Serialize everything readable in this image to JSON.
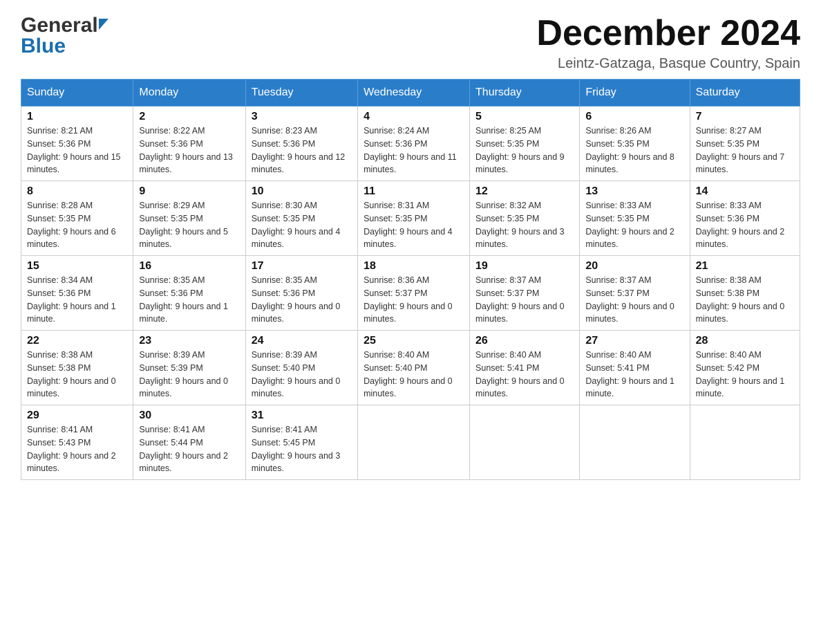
{
  "header": {
    "logo_general": "General",
    "logo_blue": "Blue",
    "month_title": "December 2024",
    "location": "Leintz-Gatzaga, Basque Country, Spain"
  },
  "weekdays": [
    "Sunday",
    "Monday",
    "Tuesday",
    "Wednesday",
    "Thursday",
    "Friday",
    "Saturday"
  ],
  "weeks": [
    [
      {
        "day": "1",
        "sunrise": "8:21 AM",
        "sunset": "5:36 PM",
        "daylight": "9 hours and 15 minutes."
      },
      {
        "day": "2",
        "sunrise": "8:22 AM",
        "sunset": "5:36 PM",
        "daylight": "9 hours and 13 minutes."
      },
      {
        "day": "3",
        "sunrise": "8:23 AM",
        "sunset": "5:36 PM",
        "daylight": "9 hours and 12 minutes."
      },
      {
        "day": "4",
        "sunrise": "8:24 AM",
        "sunset": "5:36 PM",
        "daylight": "9 hours and 11 minutes."
      },
      {
        "day": "5",
        "sunrise": "8:25 AM",
        "sunset": "5:35 PM",
        "daylight": "9 hours and 9 minutes."
      },
      {
        "day": "6",
        "sunrise": "8:26 AM",
        "sunset": "5:35 PM",
        "daylight": "9 hours and 8 minutes."
      },
      {
        "day": "7",
        "sunrise": "8:27 AM",
        "sunset": "5:35 PM",
        "daylight": "9 hours and 7 minutes."
      }
    ],
    [
      {
        "day": "8",
        "sunrise": "8:28 AM",
        "sunset": "5:35 PM",
        "daylight": "9 hours and 6 minutes."
      },
      {
        "day": "9",
        "sunrise": "8:29 AM",
        "sunset": "5:35 PM",
        "daylight": "9 hours and 5 minutes."
      },
      {
        "day": "10",
        "sunrise": "8:30 AM",
        "sunset": "5:35 PM",
        "daylight": "9 hours and 4 minutes."
      },
      {
        "day": "11",
        "sunrise": "8:31 AM",
        "sunset": "5:35 PM",
        "daylight": "9 hours and 4 minutes."
      },
      {
        "day": "12",
        "sunrise": "8:32 AM",
        "sunset": "5:35 PM",
        "daylight": "9 hours and 3 minutes."
      },
      {
        "day": "13",
        "sunrise": "8:33 AM",
        "sunset": "5:35 PM",
        "daylight": "9 hours and 2 minutes."
      },
      {
        "day": "14",
        "sunrise": "8:33 AM",
        "sunset": "5:36 PM",
        "daylight": "9 hours and 2 minutes."
      }
    ],
    [
      {
        "day": "15",
        "sunrise": "8:34 AM",
        "sunset": "5:36 PM",
        "daylight": "9 hours and 1 minute."
      },
      {
        "day": "16",
        "sunrise": "8:35 AM",
        "sunset": "5:36 PM",
        "daylight": "9 hours and 1 minute."
      },
      {
        "day": "17",
        "sunrise": "8:35 AM",
        "sunset": "5:36 PM",
        "daylight": "9 hours and 0 minutes."
      },
      {
        "day": "18",
        "sunrise": "8:36 AM",
        "sunset": "5:37 PM",
        "daylight": "9 hours and 0 minutes."
      },
      {
        "day": "19",
        "sunrise": "8:37 AM",
        "sunset": "5:37 PM",
        "daylight": "9 hours and 0 minutes."
      },
      {
        "day": "20",
        "sunrise": "8:37 AM",
        "sunset": "5:37 PM",
        "daylight": "9 hours and 0 minutes."
      },
      {
        "day": "21",
        "sunrise": "8:38 AM",
        "sunset": "5:38 PM",
        "daylight": "9 hours and 0 minutes."
      }
    ],
    [
      {
        "day": "22",
        "sunrise": "8:38 AM",
        "sunset": "5:38 PM",
        "daylight": "9 hours and 0 minutes."
      },
      {
        "day": "23",
        "sunrise": "8:39 AM",
        "sunset": "5:39 PM",
        "daylight": "9 hours and 0 minutes."
      },
      {
        "day": "24",
        "sunrise": "8:39 AM",
        "sunset": "5:40 PM",
        "daylight": "9 hours and 0 minutes."
      },
      {
        "day": "25",
        "sunrise": "8:40 AM",
        "sunset": "5:40 PM",
        "daylight": "9 hours and 0 minutes."
      },
      {
        "day": "26",
        "sunrise": "8:40 AM",
        "sunset": "5:41 PM",
        "daylight": "9 hours and 0 minutes."
      },
      {
        "day": "27",
        "sunrise": "8:40 AM",
        "sunset": "5:41 PM",
        "daylight": "9 hours and 1 minute."
      },
      {
        "day": "28",
        "sunrise": "8:40 AM",
        "sunset": "5:42 PM",
        "daylight": "9 hours and 1 minute."
      }
    ],
    [
      {
        "day": "29",
        "sunrise": "8:41 AM",
        "sunset": "5:43 PM",
        "daylight": "9 hours and 2 minutes."
      },
      {
        "day": "30",
        "sunrise": "8:41 AM",
        "sunset": "5:44 PM",
        "daylight": "9 hours and 2 minutes."
      },
      {
        "day": "31",
        "sunrise": "8:41 AM",
        "sunset": "5:45 PM",
        "daylight": "9 hours and 3 minutes."
      },
      null,
      null,
      null,
      null
    ]
  ]
}
